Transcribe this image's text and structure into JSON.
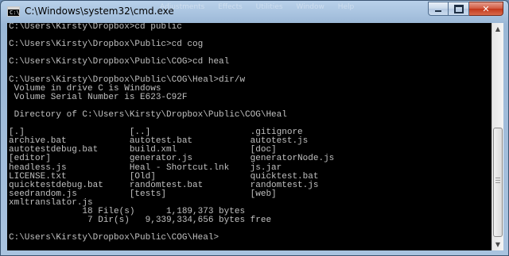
{
  "window": {
    "title": "C:\\Windows\\system32\\cmd.exe",
    "icon_label": "C:\\",
    "background_menu": "Adjustments Effects Utilities Window Help"
  },
  "caption_buttons": {
    "minimize": "minimize-icon",
    "maximize": "maximize-icon",
    "close": "✕"
  },
  "console": {
    "lines": [
      "C:\\Users\\Kirsty\\Dropbox>cd public",
      "",
      "C:\\Users\\Kirsty\\Dropbox\\Public>cd cog",
      "",
      "C:\\Users\\Kirsty\\Dropbox\\Public\\COG>cd heal",
      "",
      "C:\\Users\\Kirsty\\Dropbox\\Public\\COG\\Heal>dir/w",
      " Volume in drive C is Windows",
      " Volume Serial Number is E623-C92F",
      "",
      " Directory of C:\\Users\\Kirsty\\Dropbox\\Public\\COG\\Heal",
      "",
      "[.]                    [..]                   .gitignore",
      "archive.bat            autotest.bat           autotest.js",
      "autotestdebug.bat      build.xml              [doc]",
      "[editor]               generator.js           generatorNode.js",
      "headless.js            Heal - Shortcut.lnk    js.jar",
      "LICENSE.txt            [Old]                  quicktest.bat",
      "quicktestdebug.bat     randomtest.bat         randomtest.js",
      "seedrandom.js          [tests]                [web]",
      "xmltranslator.js",
      "              18 File(s)      1,189,373 bytes",
      "               7 Dir(s)   9,339,334,656 bytes free",
      "",
      "C:\\Users\\Kirsty\\Dropbox\\Public\\COG\\Heal>",
      ""
    ]
  },
  "scrollbar": {
    "up_arrow": "▲",
    "down_arrow": "▼"
  }
}
